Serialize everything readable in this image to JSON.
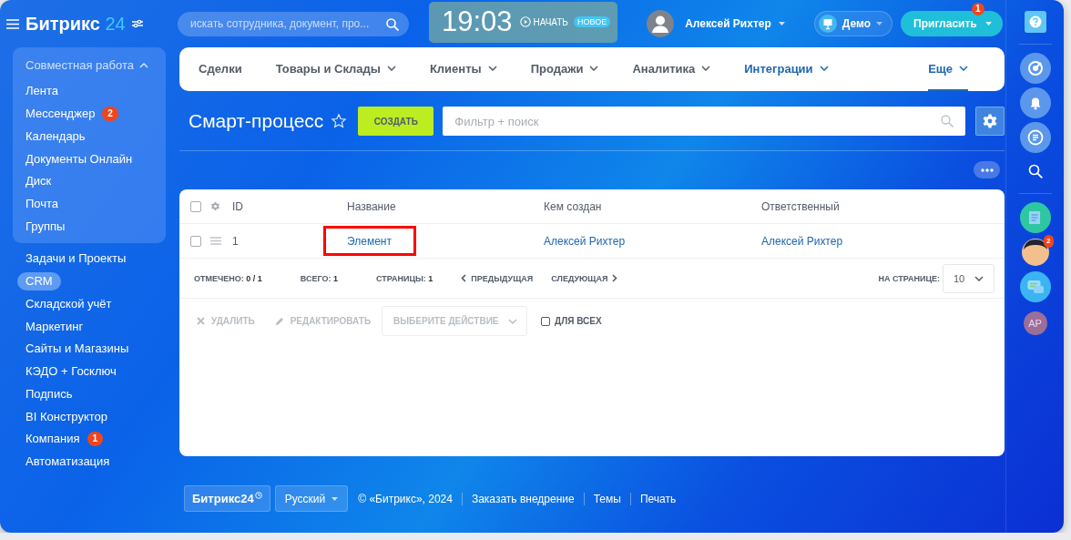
{
  "header": {
    "logo": "Битрикс",
    "logo_number": "24",
    "search": {
      "placeholder": "искать сотрудника, документ, про..."
    },
    "clock": {
      "time": "19:03",
      "start_label": "НАЧАТЬ",
      "badge": "НОВОЕ"
    },
    "user": {
      "name": "Алексей Рихтер"
    },
    "demo": "Демо",
    "invite": {
      "label": "Пригласить",
      "count": "1"
    }
  },
  "sidebar": {
    "group": {
      "title": "Совместная работа",
      "expanded": true,
      "items": [
        {
          "label": "Лента",
          "selected": false
        },
        {
          "label": "Мессенджер",
          "selected": false,
          "badge": "2"
        },
        {
          "label": "Календарь",
          "selected": false
        },
        {
          "label": "Документы Онлайн",
          "selected": false
        },
        {
          "label": "Диск",
          "selected": false
        },
        {
          "label": "Почта",
          "selected": false
        },
        {
          "label": "Группы",
          "selected": false
        }
      ]
    },
    "items": [
      {
        "label": "Задачи и Проекты",
        "selected": false
      },
      {
        "label": "CRM",
        "selected": true
      },
      {
        "label": "Складской учёт",
        "selected": false
      },
      {
        "label": "Маркетинг",
        "selected": false
      },
      {
        "label": "Сайты и Магазины",
        "selected": false
      },
      {
        "label": "КЭДО + Госключ",
        "selected": false
      },
      {
        "label": "Подпись",
        "selected": false
      },
      {
        "label": "BI Конструктор",
        "selected": false
      },
      {
        "label": "Компания",
        "selected": false,
        "badge": "1"
      },
      {
        "label": "Автоматизация",
        "selected": false
      }
    ]
  },
  "nav": [
    {
      "label": "Сделки",
      "dropdown": false,
      "accent": false,
      "selected": false
    },
    {
      "label": "Товары и Склады",
      "dropdown": true,
      "accent": false,
      "selected": false
    },
    {
      "label": "Клиенты",
      "dropdown": true,
      "accent": false,
      "selected": false
    },
    {
      "label": "Продажи",
      "dropdown": true,
      "accent": false,
      "selected": false
    },
    {
      "label": "Аналитика",
      "dropdown": true,
      "accent": false,
      "selected": false
    },
    {
      "label": "Интеграции",
      "dropdown": true,
      "accent": true,
      "selected": false
    },
    {
      "label": "Еще",
      "dropdown": true,
      "accent": true,
      "selected": true
    }
  ],
  "page": {
    "title": "Смарт-процесс",
    "create_button": "СОЗДАТЬ",
    "filter": {
      "placeholder": "Фильтр + поиск"
    }
  },
  "table": {
    "all_checked": false,
    "columns": [
      "ID",
      "Название",
      "Кем создан",
      "Ответственный"
    ],
    "rows": [
      {
        "checked": false,
        "highlighted": true,
        "cells": [
          "1",
          "Элемент",
          "Алексей Рихтер",
          "Алексей Рихтер"
        ]
      }
    ]
  },
  "summary": {
    "checked_label": "ОТМЕЧЕНО:",
    "checked_value": "0 / 1",
    "total_label": "ВСЕГО:",
    "total_value": "1",
    "pages_label": "СТРАНИЦЫ:",
    "pages_value": "1",
    "prev": "ПРЕДЫДУЩАЯ",
    "next": "СЛЕДУЮЩАЯ",
    "per_page_label": "НА СТРАНИЦЕ:",
    "per_page": "10"
  },
  "actions": {
    "delete": "УДАЛИТЬ",
    "edit": "РЕДАКТИРОВАТЬ",
    "select": {
      "placeholder": "ВЫБЕРИТЕ ДЕЙСТВИЕ"
    },
    "for_all": {
      "label": "ДЛЯ ВСЕХ",
      "checked": false
    }
  },
  "footer": {
    "logo": "Битрикс24",
    "language": "Русский",
    "copyright": "© «Битрикс», 2024",
    "links": [
      "Заказать внедрение",
      "Темы",
      "Печать"
    ]
  },
  "right_bar": {
    "chat_badge": "2",
    "initials": "АР"
  }
}
